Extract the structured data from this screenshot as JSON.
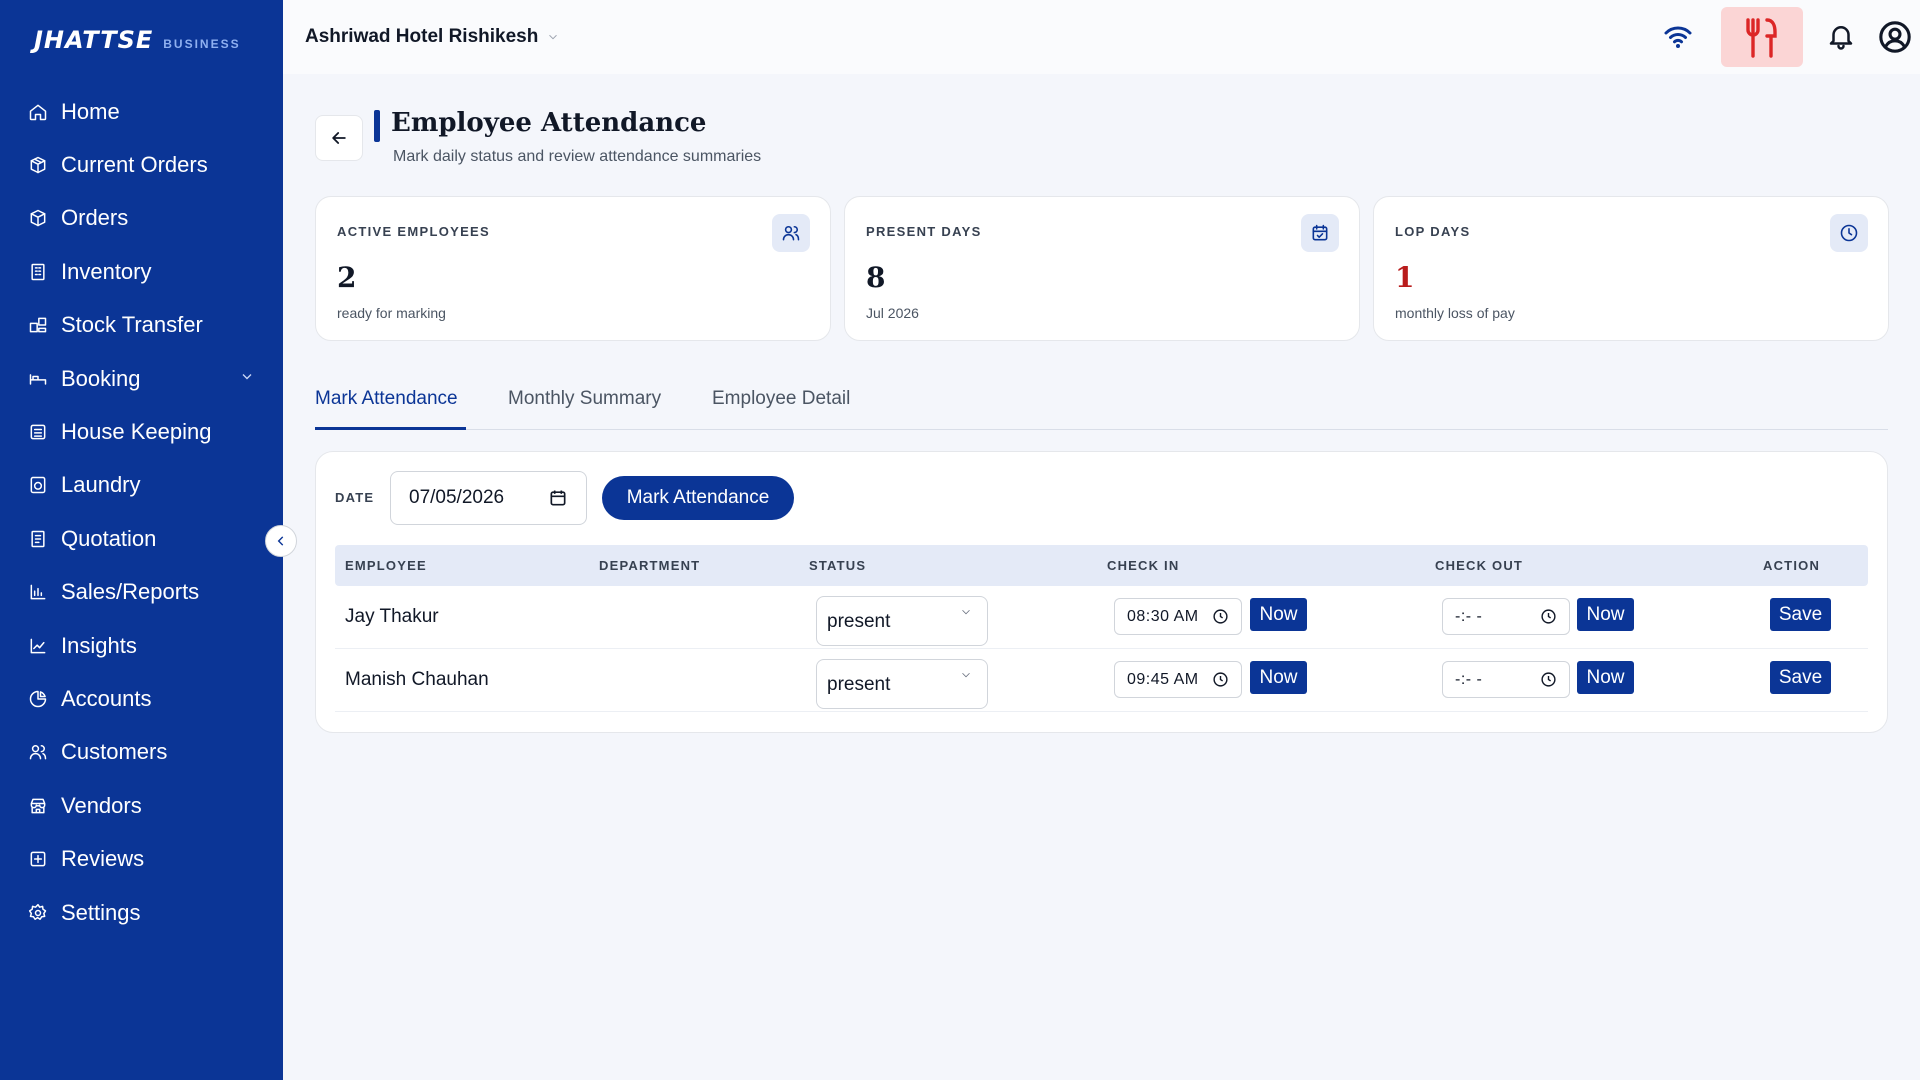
{
  "brand": {
    "name": "JHATTSE",
    "tagline": "BUSINESS"
  },
  "sidebar": {
    "items": [
      {
        "label": "Home",
        "icon": "home-icon"
      },
      {
        "label": "Current Orders",
        "icon": "box-icon"
      },
      {
        "label": "Orders",
        "icon": "package-icon"
      },
      {
        "label": "Inventory",
        "icon": "building-icon"
      },
      {
        "label": "Stock Transfer",
        "icon": "transfer-icon"
      },
      {
        "label": "Booking",
        "icon": "bed-icon",
        "expandable": true
      },
      {
        "label": "House Keeping",
        "icon": "housekeeping-icon"
      },
      {
        "label": "Laundry",
        "icon": "washer-icon"
      },
      {
        "label": "Quotation",
        "icon": "quotation-icon"
      },
      {
        "label": "Sales/Reports",
        "icon": "bar-chart-icon"
      },
      {
        "label": "Insights",
        "icon": "line-chart-icon"
      },
      {
        "label": "Accounts",
        "icon": "pie-chart-icon"
      },
      {
        "label": "Customers",
        "icon": "users-icon"
      },
      {
        "label": "Vendors",
        "icon": "store-icon"
      },
      {
        "label": "Reviews",
        "icon": "review-icon"
      },
      {
        "label": "Settings",
        "icon": "gear-icon"
      }
    ]
  },
  "topbar": {
    "hotel": "Ashriwad Hotel Rishikesh"
  },
  "header": {
    "title": "Employee Attendance",
    "subtitle": "Mark daily status and review attendance summaries"
  },
  "stats": [
    {
      "label": "ACTIVE EMPLOYEES",
      "value": "2",
      "sub": "ready for marking",
      "icon": "users-icon"
    },
    {
      "label": "PRESENT DAYS",
      "value": "8",
      "sub": "Jul 2026",
      "icon": "calendar-check-icon"
    },
    {
      "label": "LOP DAYS",
      "value": "1",
      "sub": "monthly loss of pay",
      "icon": "clock-icon",
      "value_color": "#b91c1c"
    }
  ],
  "tabs": [
    "Mark Attendance",
    "Monthly Summary",
    "Employee Detail"
  ],
  "active_tab": "Mark Attendance",
  "form": {
    "date_label": "DATE",
    "date_value": "07/05/2026",
    "mark_button": "Mark Attendance"
  },
  "table": {
    "columns": [
      "EMPLOYEE",
      "DEPARTMENT",
      "STATUS",
      "CHECK IN",
      "CHECK OUT",
      "ACTION"
    ],
    "rows": [
      {
        "employee": "Jay Thakur",
        "department": "",
        "status": "present",
        "check_in": "08:30 AM",
        "check_out": "-:- -",
        "now_label": "Now",
        "save_label": "Save"
      },
      {
        "employee": "Manish Chauhan",
        "department": "",
        "status": "present",
        "check_in": "09:45 AM",
        "check_out": "-:- -",
        "now_label": "Now",
        "save_label": "Save"
      }
    ]
  },
  "colors": {
    "primary": "#0b3596",
    "danger": "#b91c1c",
    "dining_bg": "#fbd5d5"
  }
}
